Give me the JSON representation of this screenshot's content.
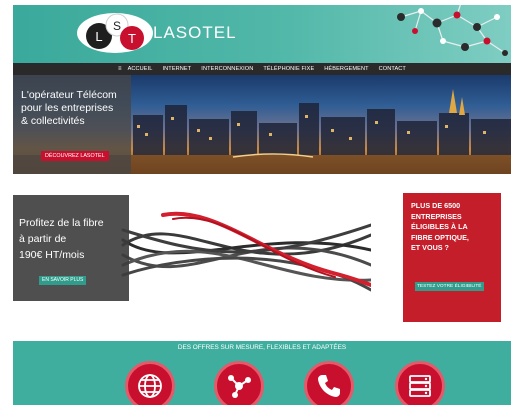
{
  "header": {
    "logo_letters": [
      "L",
      "S",
      "T"
    ],
    "brand": "LASOTEL"
  },
  "nav": {
    "home_icon": "home-icon",
    "items": [
      "ACCUEIL",
      "INTERNET",
      "INTERCONNEXION",
      "TÉLÉPHONIE FIXE",
      "HÉBERGEMENT",
      "CONTACT"
    ]
  },
  "hero": {
    "lines": [
      "L'opérateur Télécom",
      "pour les entreprises",
      "& collectivités"
    ],
    "button": "DÉCOUVREZ LASOTEL"
  },
  "fibre": {
    "lines": [
      "Profitez de la fibre",
      "à partir de",
      "190€ HT/mois"
    ],
    "button": "EN SAVOIR PLUS"
  },
  "eligibility": {
    "lines": [
      "PLUS DE 6500",
      "ENTREPRISES",
      "ÉLIGIBLES À LA",
      "FIBRE OPTIQUE,",
      "ET VOUS ?"
    ],
    "button": "TESTEZ VOTRE ÉLIGIBILITÉ"
  },
  "offers": {
    "title": "DES OFFRES SUR MESURE, FLEXIBLES ET ADAPTÉES",
    "icons": [
      "globe-icon",
      "network-icon",
      "phone-icon",
      "server-icon"
    ]
  },
  "colors": {
    "teal": "#3fae9f",
    "red": "#c8102e",
    "dark": "#2a2a2a"
  }
}
